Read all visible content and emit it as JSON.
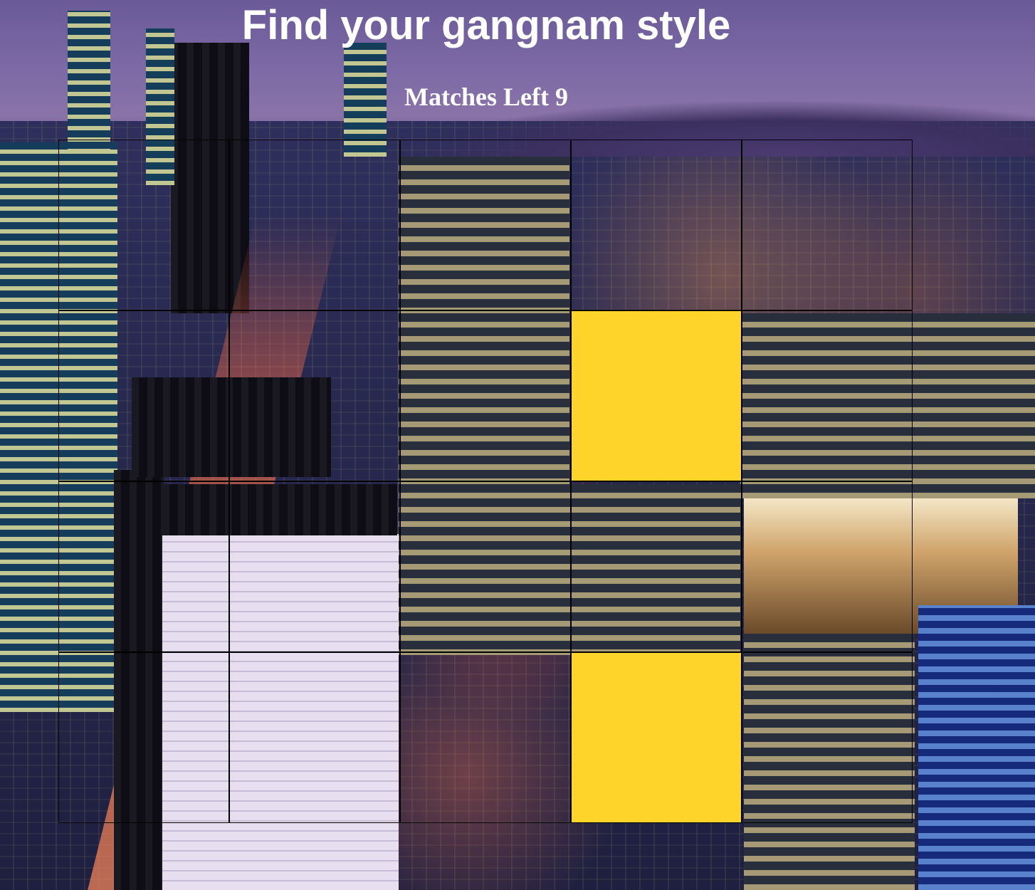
{
  "title": "Find your gangnam style",
  "status": {
    "label": "Matches Left",
    "count": 9,
    "text": "Matches Left 9"
  },
  "board": {
    "rows": 4,
    "columns": 5,
    "card_back": "transparent",
    "revealed_color": "#fed42a",
    "border_color": "#000000",
    "cells": [
      [
        false,
        false,
        false,
        false,
        false
      ],
      [
        false,
        false,
        false,
        true,
        false
      ],
      [
        false,
        false,
        false,
        false,
        false
      ],
      [
        false,
        false,
        false,
        true,
        false
      ]
    ]
  },
  "background": {
    "subject": "night city skyline",
    "accent_colors": [
      "#6a5a98",
      "#1b4a66",
      "#ff6a3c",
      "#fed42a"
    ]
  }
}
